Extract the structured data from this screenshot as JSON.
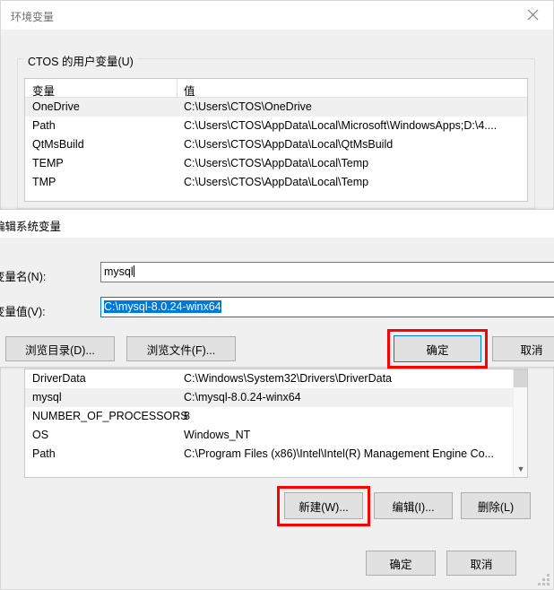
{
  "env_window": {
    "title": "环境变量",
    "close_icon": "close-icon",
    "user_group": {
      "legend": "CTOS 的用户变量(U)",
      "columns": [
        "变量",
        "值"
      ],
      "rows": [
        {
          "name": "OneDrive",
          "value": "C:\\Users\\CTOS\\OneDrive",
          "selected": true
        },
        {
          "name": "Path",
          "value": "C:\\Users\\CTOS\\AppData\\Local\\Microsoft\\WindowsApps;D:\\4....",
          "selected": false
        },
        {
          "name": "QtMsBuild",
          "value": "C:\\Users\\CTOS\\AppData\\Local\\QtMsBuild",
          "selected": false
        },
        {
          "name": "TEMP",
          "value": "C:\\Users\\CTOS\\AppData\\Local\\Temp",
          "selected": false
        },
        {
          "name": "TMP",
          "value": "C:\\Users\\CTOS\\AppData\\Local\\Temp",
          "selected": false
        }
      ]
    },
    "system_list": {
      "rows": [
        {
          "name": "DriverData",
          "value": "C:\\Windows\\System32\\Drivers\\DriverData",
          "selected": false
        },
        {
          "name": "mysql",
          "value": "C:\\mysql-8.0.24-winx64",
          "selected": true
        },
        {
          "name": "NUMBER_OF_PROCESSORS",
          "value": "8",
          "selected": false
        },
        {
          "name": "OS",
          "value": "Windows_NT",
          "selected": false
        },
        {
          "name": "Path",
          "value": "C:\\Program Files (x86)\\Intel\\Intel(R) Management Engine Co...",
          "selected": false
        }
      ],
      "scroll_down_icon": "chevron-down-icon"
    },
    "buttons": {
      "new": "新建(W)...",
      "edit": "编辑(I)...",
      "delete": "删除(L)",
      "ok": "确定",
      "cancel": "取消"
    }
  },
  "edit_dialog": {
    "title": "编辑系统变量",
    "close_icon": "close-icon",
    "label_name": "变量名(N):",
    "label_value": "变量值(V):",
    "value_name": "mysql",
    "value_value": "C:\\mysql-8.0.24-winx64",
    "buttons": {
      "browse_dir": "浏览目录(D)...",
      "browse_file": "浏览文件(F)...",
      "ok": "确定",
      "cancel": "取消"
    }
  },
  "highlights": {
    "color": "#ff0000",
    "targets": [
      "edit-dialog-ok-button",
      "new-button"
    ]
  }
}
